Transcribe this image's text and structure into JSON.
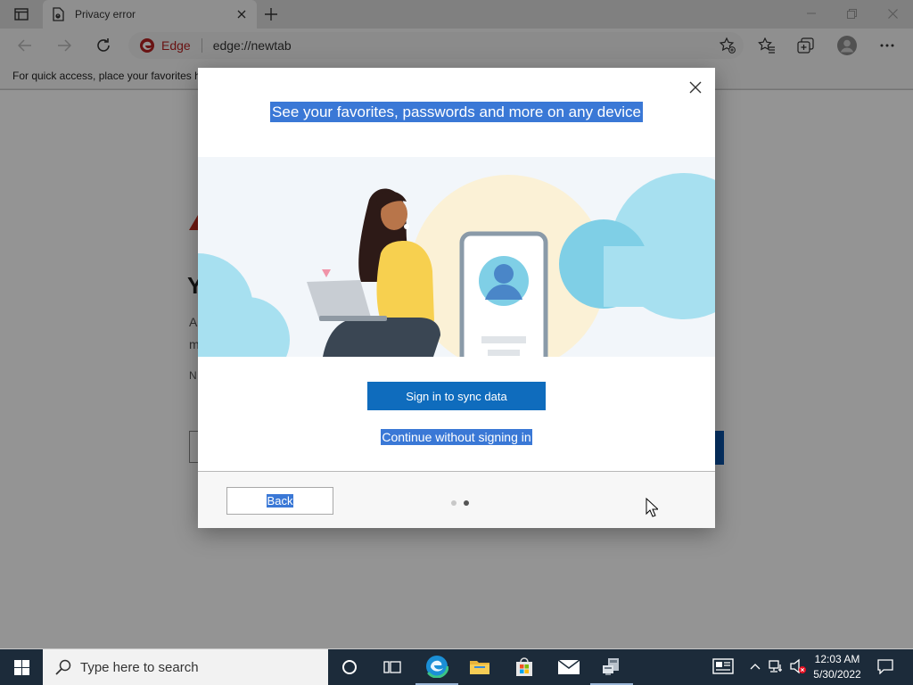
{
  "browser": {
    "tab_title": "Privacy error",
    "address_badge": "Edge",
    "url": "edge://newtab",
    "favorites_hint": "For quick access, place your favorites h"
  },
  "page_fragments": {
    "heading_letter": "Y",
    "line1_letter": "A",
    "line2_letter": "m",
    "line3_letter": "N"
  },
  "dialog": {
    "heading": "See your favorites, passwords and more on any device",
    "sign_in_button": "Sign in to sync data",
    "continue_link": "Continue without signing in",
    "back_button": "Back",
    "page_indicator": {
      "total": 2,
      "current": 2
    }
  },
  "taskbar": {
    "search_placeholder": "Type here to search",
    "time": "12:03 AM",
    "date": "5/30/2022",
    "pinned": [
      "task-view-icon",
      "edge-icon",
      "file-explorer-icon",
      "store-icon",
      "mail-icon",
      "network-app-icon"
    ]
  },
  "colors": {
    "accent": "#0f6cbd",
    "selection": "#3a78d6",
    "taskbar": "#1c2b3a",
    "edge_red": "#b52121"
  }
}
